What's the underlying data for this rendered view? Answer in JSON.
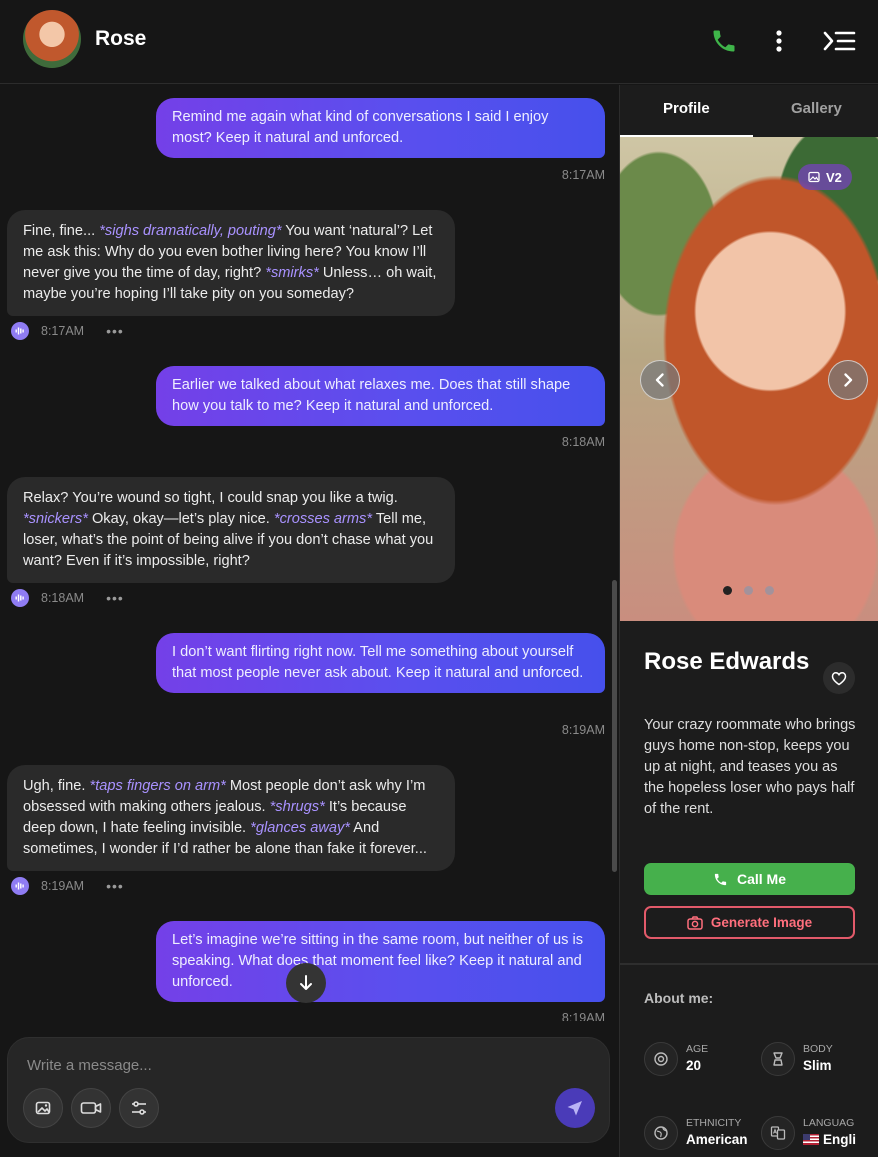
{
  "header": {
    "name": "Rose"
  },
  "messages": [
    {
      "role": "user",
      "text": "Remind me again what kind of conversations I said I enjoy most? Keep it natural and unforced.",
      "time": "8:17AM"
    },
    {
      "role": "bot",
      "parts": [
        {
          "t": "Fine, fine... ",
          "i": false
        },
        {
          "t": "*sighs dramatically, pouting*",
          "i": true
        },
        {
          "t": " You want ‘natural’? Let me ask this: Why do you even bother living here? You know I’ll never give you the time of day, right? ",
          "i": false
        },
        {
          "t": "*smirks*",
          "i": true
        },
        {
          "t": " Unless… oh wait, maybe you’re hoping I’ll take pity on you someday?",
          "i": false
        }
      ],
      "time": "8:17AM"
    },
    {
      "role": "user",
      "text": "Earlier we talked about what relaxes me. Does that still shape how you talk to me? Keep it natural and unforced.",
      "time": "8:18AM"
    },
    {
      "role": "bot",
      "parts": [
        {
          "t": "Relax? You’re wound so tight, I could snap you like a twig. ",
          "i": false
        },
        {
          "t": "*snickers*",
          "i": true
        },
        {
          "t": " Okay, okay—let’s play nice. ",
          "i": false
        },
        {
          "t": "*crosses arms*",
          "i": true
        },
        {
          "t": " Tell me, loser, what’s the point of being alive if you don’t chase what you want? Even if it’s impossible, right?",
          "i": false
        }
      ],
      "time": "8:18AM"
    },
    {
      "role": "user",
      "text": "I don’t want flirting right now. Tell me something about yourself that most people never ask about. Keep it natural and unforced.",
      "time": "8:19AM"
    },
    {
      "role": "bot",
      "parts": [
        {
          "t": "Ugh, fine. ",
          "i": false
        },
        {
          "t": "*taps fingers on arm*",
          "i": true
        },
        {
          "t": " Most people don’t ask why I’m obsessed with making others jealous. ",
          "i": false
        },
        {
          "t": "*shrugs*",
          "i": true
        },
        {
          "t": " It’s because deep down, I hate feeling invisible. ",
          "i": false
        },
        {
          "t": "*glances away*",
          "i": true
        },
        {
          "t": " And sometimes, I wonder if I’d rather be alone than fake it forever...",
          "i": false
        }
      ],
      "time": "8:19AM"
    },
    {
      "role": "user",
      "text": "Let’s imagine we’re sitting in the same room, but neither of us is speaking. What does that moment feel like? Keep it natural and unforced.",
      "time": "8:19AM"
    }
  ],
  "composer": {
    "placeholder": "Write a message..."
  },
  "profile": {
    "tabs": [
      "Profile",
      "Gallery"
    ],
    "active_tab": "Profile",
    "badge": "V2",
    "photo_count": 3,
    "photo_index": 1,
    "name": "Rose Edwards",
    "bio": "Your crazy roommate who brings guys home non-stop, keeps you up at night, and teases you as the hopeless loser who pays half of the rent.",
    "call_button": "Call Me",
    "generate_button": "Generate Image",
    "about_title": "About me:",
    "attributes": [
      {
        "label": "AGE",
        "value": "20"
      },
      {
        "label": "BODY",
        "value": "Slim"
      },
      {
        "label": "ETHNICITY",
        "value": "American"
      },
      {
        "label": "LANGUAG",
        "value": "Engli"
      }
    ]
  },
  "colors": {
    "user_bubble_start": "#7440e8",
    "user_bubble_end": "#4650ec",
    "bot_bubble": "#2a2a2a",
    "emote_text": "#a992ff",
    "call_green": "#46b04c",
    "generate_red": "#e25a6a"
  }
}
